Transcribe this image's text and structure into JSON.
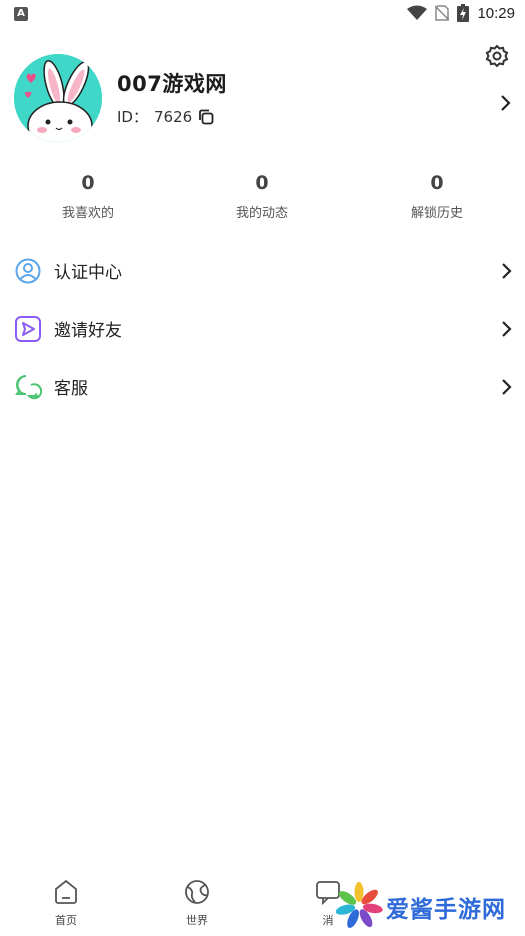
{
  "status_bar": {
    "time": "10:29",
    "left_icon": "A"
  },
  "profile": {
    "name": "007游戏网",
    "id_label": "ID：",
    "id_value": "7626"
  },
  "stats": [
    {
      "value": "0",
      "label": "我喜欢的"
    },
    {
      "value": "0",
      "label": "我的动态"
    },
    {
      "value": "0",
      "label": "解锁历史"
    }
  ],
  "menu": [
    {
      "label": "认证中心",
      "icon": "user-circle-icon",
      "color": "#5aa6e8"
    },
    {
      "label": "邀请好友",
      "icon": "send-icon",
      "color": "#8b5cf6"
    },
    {
      "label": "客服",
      "icon": "chat-bubbles-icon",
      "color": "#4cc472"
    }
  ],
  "tabs": [
    {
      "label": "首页",
      "icon": "home-icon"
    },
    {
      "label": "世界",
      "icon": "globe-icon"
    },
    {
      "label": "消",
      "icon": "message-icon"
    }
  ],
  "watermark": {
    "text": "爱酱手游网"
  },
  "colors": {
    "avatar_bg": "#3ed7c8",
    "accent_blue": "#2f6bd8"
  }
}
